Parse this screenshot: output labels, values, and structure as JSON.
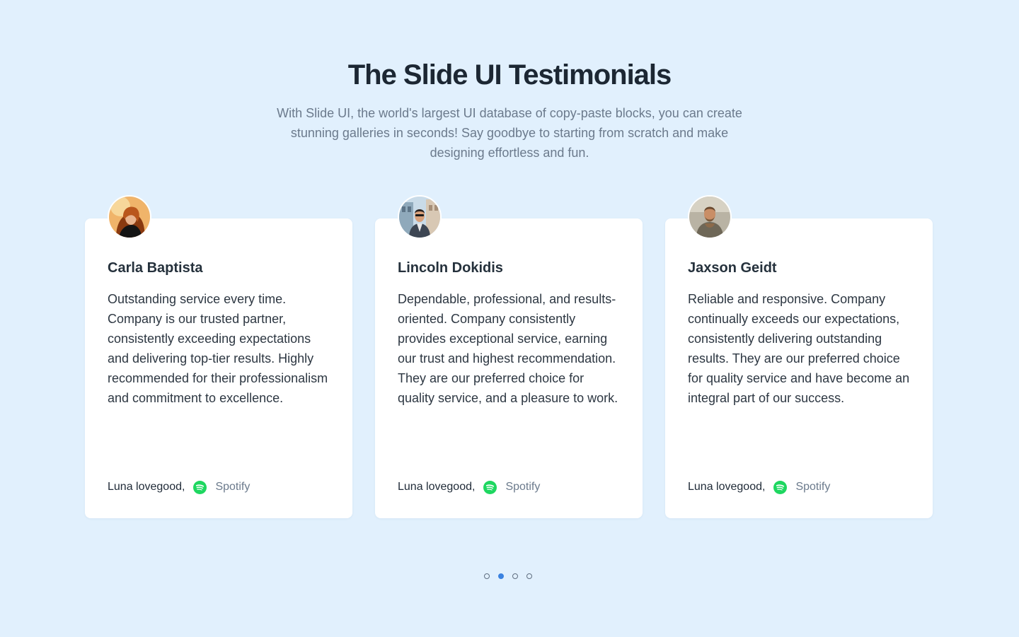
{
  "header": {
    "title": "The Slide UI Testimonials",
    "subtitle": "With Slide UI, the world's largest UI database of copy-paste blocks, you can create stunning galleries in seconds! Say goodbye to starting from scratch and make designing effortless and fun."
  },
  "testimonials": [
    {
      "name": "Carla Baptista",
      "quote": "Outstanding service every time. Company is our trusted partner, consistently exceeding expectations and delivering top-tier results. Highly recommended for their professionalism and commitment to excellence.",
      "author": "Luna lovegood",
      "comma": ",",
      "company": "Spotify",
      "company_icon": "spotify-icon"
    },
    {
      "name": "Lincoln Dokidis",
      "quote": "Dependable, professional, and results-oriented. Company consistently provides exceptional service, earning our trust and highest recommendation. They are our preferred choice for quality service, and a pleasure to work.",
      "author": "Luna lovegood",
      "comma": ",",
      "company": "Spotify",
      "company_icon": "spotify-icon"
    },
    {
      "name": "Jaxson Geidt",
      "quote": "Reliable and responsive. Company continually exceeds our expectations, consistently delivering outstanding results. They are our preferred choice for quality service and have become an integral part of our success.",
      "author": "Luna lovegood",
      "comma": ",",
      "company": "Spotify",
      "company_icon": "spotify-icon"
    }
  ],
  "pagination": {
    "total": 4,
    "active_index": 1
  },
  "colors": {
    "background": "#e1f0fd",
    "card": "#ffffff",
    "accent": "#3b82e0",
    "spotify": "#1ed760"
  }
}
